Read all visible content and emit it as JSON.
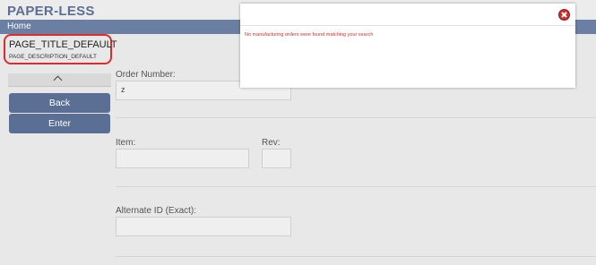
{
  "app": {
    "brand": "PAPER-LESS"
  },
  "nav": {
    "home": "Home"
  },
  "page": {
    "title": "PAGE_TITLE_DEFAULT",
    "description": "PAGE_DESCRIPTION_DEFAULT"
  },
  "sidebar": {
    "back_label": "Back",
    "enter_label": "Enter"
  },
  "form": {
    "order_number_label": "Order Number:",
    "order_number_value": "z",
    "item_label": "Item:",
    "rev_label": "Rev:",
    "alternate_id_label": "Alternate ID (Exact):"
  },
  "modal": {
    "message": "No manufacturing orders were found matching your search"
  },
  "colors": {
    "brand": "#5a6f93",
    "navbar": "#6b7fa3",
    "button": "#5b6e93",
    "error": "#e02b2b"
  },
  "icons": {
    "collapse": "chevron-up-icon",
    "close": "close-icon"
  }
}
